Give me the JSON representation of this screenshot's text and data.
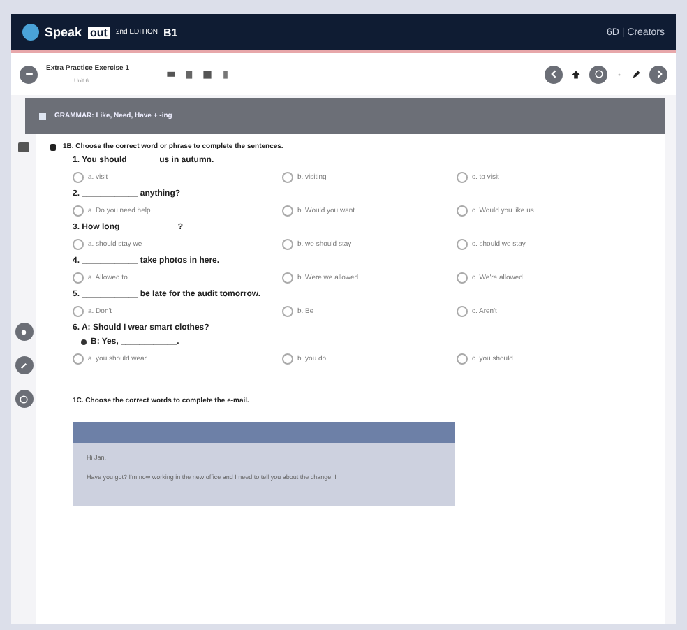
{
  "header": {
    "brand": "Speak",
    "brand_badge": "out",
    "edition": "2nd EDITION",
    "level": "B1",
    "user": "6D | Creators"
  },
  "toolbar": {
    "title": "Extra Practice Exercise 1",
    "subtitle": "Unit 6"
  },
  "banner": {
    "text": "GRAMMAR: Like, Need, Have + -ing"
  },
  "sections": [
    {
      "instruction": "1B. Choose the correct word or phrase to complete the sentences.",
      "questions": [
        {
          "lines": [
            "1. You should ______ us in autumn."
          ],
          "options": [
            {
              "text": "a. visit",
              "selected": false
            },
            {
              "text": "b. visiting",
              "selected": false
            },
            {
              "text": "c. to visit",
              "selected": false
            }
          ]
        },
        {
          "lines": [
            "2. ____________ anything?"
          ],
          "options": [
            {
              "text": "a. Do you need help",
              "selected": false
            },
            {
              "text": "b. Would you want",
              "selected": false
            },
            {
              "text": "c. Would you like us",
              "selected": false
            }
          ]
        },
        {
          "lines": [
            "3. How long ____________?"
          ],
          "options": [
            {
              "text": "a. should stay we",
              "selected": false
            },
            {
              "text": "b. we should stay",
              "selected": false
            },
            {
              "text": "c. should we stay",
              "selected": false
            }
          ]
        },
        {
          "lines": [
            "4. ____________ take photos in here."
          ],
          "options": [
            {
              "text": "a. Allowed to",
              "selected": false
            },
            {
              "text": "b. Were we allowed",
              "selected": false
            },
            {
              "text": "c. We're allowed",
              "selected": false
            }
          ]
        },
        {
          "lines": [
            "5. ____________ be late for the audit tomorrow."
          ],
          "options": [
            {
              "text": "a. Don't",
              "selected": false
            },
            {
              "text": "b. Be",
              "selected": false
            },
            {
              "text": "c. Aren't",
              "selected": false
            }
          ]
        },
        {
          "lines": [
            "6. A: Should I wear smart clothes?",
            "B: Yes, ____________."
          ],
          "options": [
            {
              "text": "a. you should wear",
              "selected": false
            },
            {
              "text": "b. you do",
              "selected": false
            },
            {
              "text": "c. you should",
              "selected": false
            }
          ]
        }
      ]
    },
    {
      "instruction": "1C. Choose the correct words to complete the e-mail.",
      "email": {
        "greeting": "Hi Jan,",
        "body": "Have you got? I'm now working in the new office and I need to tell you about the change. I"
      }
    }
  ]
}
